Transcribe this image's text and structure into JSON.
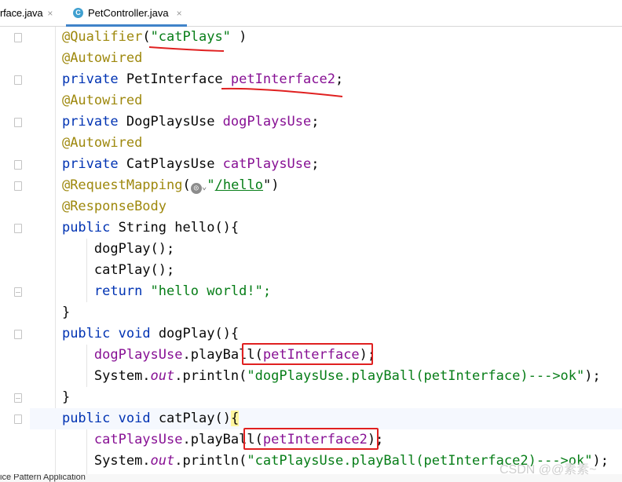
{
  "tabs": [
    {
      "label": "rface.java",
      "close": "×"
    },
    {
      "label": "PetController.java",
      "icon": "C",
      "close": "×"
    }
  ],
  "code": {
    "qualifier_annotation": "@Qualifier",
    "qualifier_open": "(",
    "qualifier_value": "\"catPlays\"",
    "qualifier_close": " )",
    "autowired": "@Autowired",
    "private": "private",
    "public": "public",
    "void": "void",
    "return": "return",
    "type_petinterface": " PetInterface ",
    "field_petinterface2": "petInterface2",
    "semicolon": ";",
    "type_dogplaysuse": " DogPlaysUse ",
    "field_dogplaysuse": "dogPlaysUse",
    "type_catplaysuse": " CatPlaysUse ",
    "field_catplaysuse": "catPlaysUse",
    "request_mapping": "@RequestMapping",
    "rm_open": "(",
    "rm_chevron": "⌄",
    "rm_quote_open": "\"",
    "rm_url": "/hello",
    "rm_quote_close": "\")",
    "response_body": "@ResponseBody",
    "string_type": " String ",
    "hello_decl": "hello(){",
    "dogplay_call": "dogPlay();",
    "catplay_call": "catPlay();",
    "return_value": " \"hello world!\";",
    "close_brace": "}",
    "dogplay_decl": " dogPlay(){",
    "dog_playball": ".playBall(",
    "petinterface_arg": "petInterface",
    "call_close": ");",
    "system": "System.",
    "out": "out",
    "println_open": ".println(",
    "dog_message": "\"dogPlaysUse.playBall(petInterface)--->ok\"",
    "catplay_decl_name": " catPlay()",
    "catplay_decl_brace": "{",
    "cat_playball": ".playBall(",
    "petinterface2_arg": "petInterface2",
    "cat_message": "\"catPlaysUse.playBall(petInterface2)--->ok\""
  },
  "status_bar": {
    "text": "ice Pattern Application"
  },
  "watermark": "CSDN @@素素~",
  "colors": {
    "keyword": "#0033b3",
    "annotation": "#9e880d",
    "string": "#067d17",
    "field": "#871094",
    "highlight_red": "#e02020",
    "tab_accent": "#4083c9"
  }
}
